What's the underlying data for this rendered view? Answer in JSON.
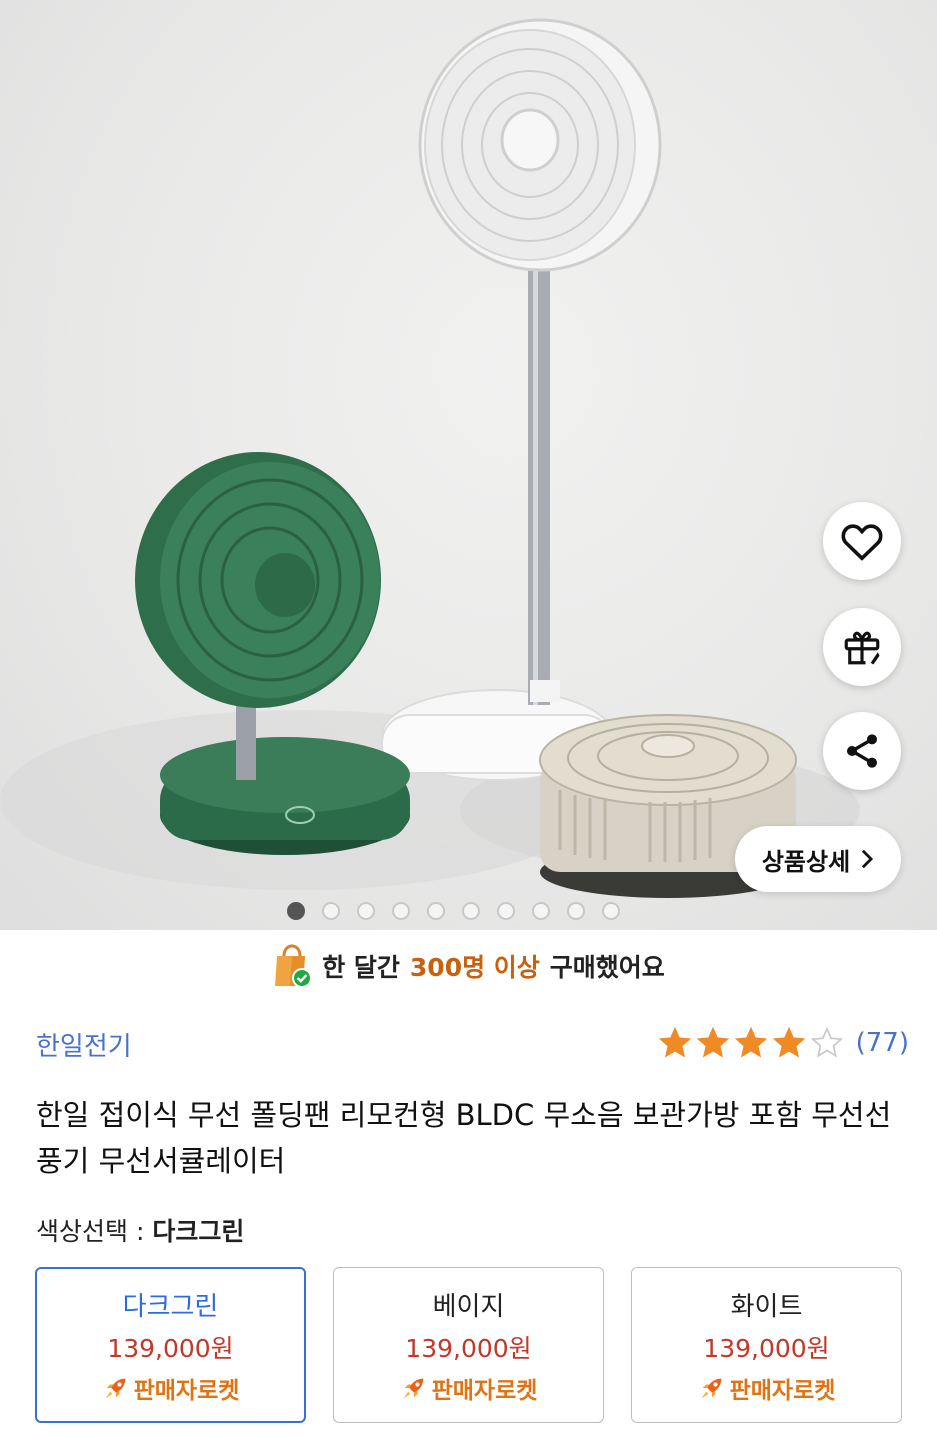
{
  "hero": {
    "image_alt": "",
    "page_count": 10,
    "active_page": 0,
    "detail_button_label": "상품상세"
  },
  "icons": {
    "like": "heart-icon",
    "gift": "gift-icon",
    "share": "share-icon",
    "bag": "shopping-bag-check-icon",
    "star": "star-icon",
    "rocket": "rocket-icon",
    "chevron": "chevron-right-icon"
  },
  "colors": {
    "brand_link": "#4a72c8",
    "highlight": "#c8610e",
    "star": "#f08a24",
    "selected_border": "#3a6fd8",
    "price": "#c0392b",
    "rocket_text": "#e07415"
  },
  "purchase_banner": {
    "prefix": "한 달간",
    "highlight": "300명 이상",
    "suffix": "구매했어요"
  },
  "brand": "한일전기",
  "rating": {
    "stars": 4,
    "max": 5,
    "count_label": "(77)"
  },
  "title": "한일 접이식 무선 폴딩팬 리모컨형 BLDC 무소음 보관가방 포함 무선선풍기 무선서큘레이터",
  "option": {
    "label": "색상선택 : ",
    "selected_value": "다크그린",
    "choices": [
      {
        "name": "다크그린",
        "price": "139,000원",
        "badge": "판매자로켓",
        "selected": true
      },
      {
        "name": "베이지",
        "price": "139,000원",
        "badge": "판매자로켓",
        "selected": false
      },
      {
        "name": "화이트",
        "price": "139,000원",
        "badge": "판매자로켓",
        "selected": false
      }
    ]
  }
}
